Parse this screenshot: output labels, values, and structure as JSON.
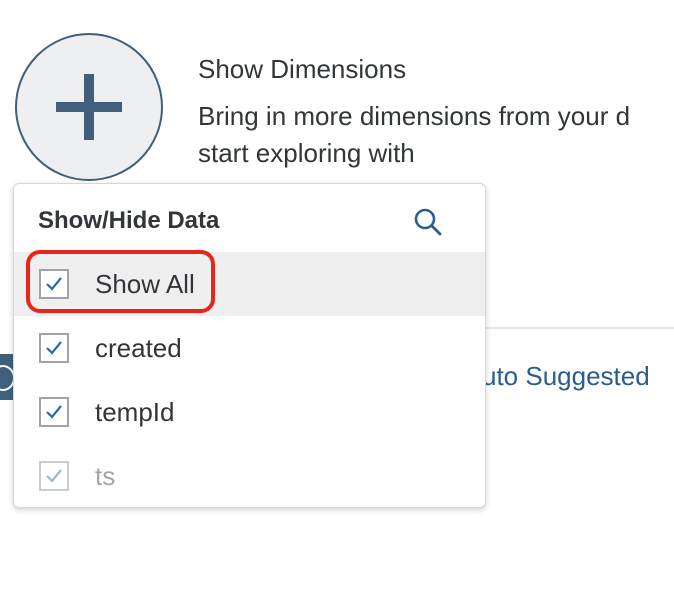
{
  "intro": {
    "title": "Show Dimensions",
    "description_line1": "Bring in more dimensions from your d",
    "description_line2": "start exploring with",
    "add_icon": "plus-icon"
  },
  "background": {
    "auto_suggested": "uto Suggested"
  },
  "popover": {
    "title": "Show/Hide Data",
    "search_icon": "search-icon",
    "items": [
      {
        "label": "Show All",
        "checked": true,
        "highlighted": true
      },
      {
        "label": "created",
        "checked": true
      },
      {
        "label": "tempId",
        "checked": true
      },
      {
        "label": "ts",
        "checked": true,
        "disabled": true
      }
    ]
  },
  "colors": {
    "accent": "#3f5f7d",
    "link": "#2b5d8c",
    "checkmark": "#2b6aa8",
    "highlight_box": "#e8251a",
    "selected_row": "#efefef"
  }
}
